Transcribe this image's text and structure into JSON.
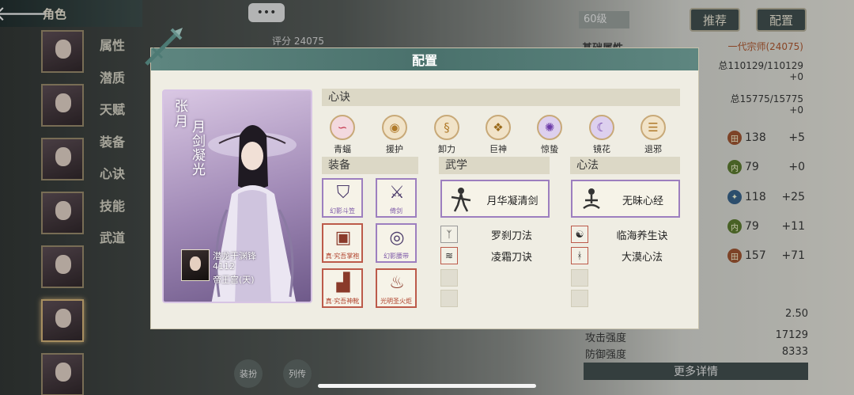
{
  "topbar": {
    "back_icon": "arrow-left-icon",
    "title": "角色"
  },
  "side_tabs": [
    "属性",
    "潜质",
    "天赋",
    "装备",
    "心诀",
    "技能",
    "武道"
  ],
  "chat_button": "•••",
  "level_badge": "60级",
  "top_buttons": {
    "recommend": "推荐",
    "config": "配置"
  },
  "background": {
    "score_text": "评分 24075",
    "base_attr_title": "基础属性",
    "rank_text": "一代宗师(24075)",
    "hp_line": "总110129/110129",
    "hp_delta": "+0",
    "mp_line": "总15775/15775",
    "mp_delta": "+0",
    "stats": [
      {
        "icon": "田",
        "value": "138",
        "delta": "+5"
      },
      {
        "icon": "内",
        "value": "79",
        "delta": "+0"
      },
      {
        "icon": "✦",
        "value": "118",
        "delta": "+25"
      },
      {
        "icon": "内",
        "value": "79",
        "delta": "+11"
      },
      {
        "icon": "田",
        "value": "157",
        "delta": "+71"
      }
    ],
    "bottom_stats": [
      {
        "label": "",
        "value": "2.50"
      },
      {
        "label": "攻击强度",
        "value": "17129"
      },
      {
        "label": "防御强度",
        "value": "8333"
      }
    ],
    "more_details": "更多详情",
    "bottom_tabs": [
      "装扮",
      "列传"
    ]
  },
  "modal": {
    "title": "配置",
    "character": {
      "name": "张月",
      "skill_title": "月剑凝光",
      "player_name": "潜龙于渊锋",
      "player_level": "4112",
      "guild": "帝王宫(天)"
    },
    "xinjue": {
      "header": "心诀",
      "items": [
        {
          "label": "青蝠",
          "icon": "bat-icon",
          "glyph": "∽",
          "color": "#c4334a",
          "bg": "#f3d9de"
        },
        {
          "label": "援护",
          "icon": "shield-scroll-icon",
          "glyph": "◉",
          "color": "#b07a2a",
          "bg": "#f1e3c8"
        },
        {
          "label": "卸力",
          "icon": "swirl-icon",
          "glyph": "§",
          "color": "#b07a2a",
          "bg": "#f1e3c8"
        },
        {
          "label": "巨神",
          "icon": "giant-icon",
          "glyph": "❖",
          "color": "#9a6a1a",
          "bg": "#f1e3c8"
        },
        {
          "label": "惊蛰",
          "icon": "thunder-icon",
          "glyph": "✺",
          "color": "#6b3aa8",
          "bg": "#ddd0ee"
        },
        {
          "label": "镜花",
          "icon": "mirror-moon-icon",
          "glyph": "☾",
          "color": "#6b3aa8",
          "bg": "#ddd0ee"
        },
        {
          "label": "退邪",
          "icon": "talisman-icon",
          "glyph": "☰",
          "color": "#b07a2a",
          "bg": "#f1e3c8"
        }
      ]
    },
    "equipment": {
      "header": "装备",
      "slots": [
        {
          "label": "幻影斗笠",
          "icon": "hat-icon",
          "rarity": "purple",
          "glyph": "⛉"
        },
        {
          "label": "倚剑",
          "icon": "dagger-icon",
          "rarity": "purple",
          "glyph": "⚔"
        },
        {
          "label": "真·究吾掌袍",
          "icon": "robe-icon",
          "rarity": "red",
          "glyph": "▣"
        },
        {
          "label": "幻影腰带",
          "icon": "belt-icon",
          "rarity": "purple",
          "glyph": "◎"
        },
        {
          "label": "真·究吾神靴",
          "icon": "boots-icon",
          "rarity": "red",
          "glyph": "▟"
        },
        {
          "label": "光明圣火炬",
          "icon": "torch-icon",
          "rarity": "red",
          "glyph": "♨"
        }
      ]
    },
    "wuxue": {
      "header": "武学",
      "main": {
        "name": "月华凝清剑",
        "icon": "swordsman-icon"
      },
      "subs": [
        {
          "name": "罗刹刀法",
          "icon": "blade-stance-icon",
          "glyph": "ᛉ",
          "rarity": "gray"
        },
        {
          "name": "凌霜刀诀",
          "icon": "frost-blade-icon",
          "glyph": "≋",
          "rarity": "red"
        }
      ]
    },
    "xinfa": {
      "header": "心法",
      "main": {
        "name": "无昧心经",
        "icon": "meditation-icon"
      },
      "subs": [
        {
          "name": "临海养生诀",
          "icon": "sea-meditation-icon",
          "glyph": "☯",
          "rarity": "red"
        },
        {
          "name": "大漠心法",
          "icon": "desert-meditation-icon",
          "glyph": "ᚼ",
          "rarity": "red"
        }
      ]
    }
  }
}
